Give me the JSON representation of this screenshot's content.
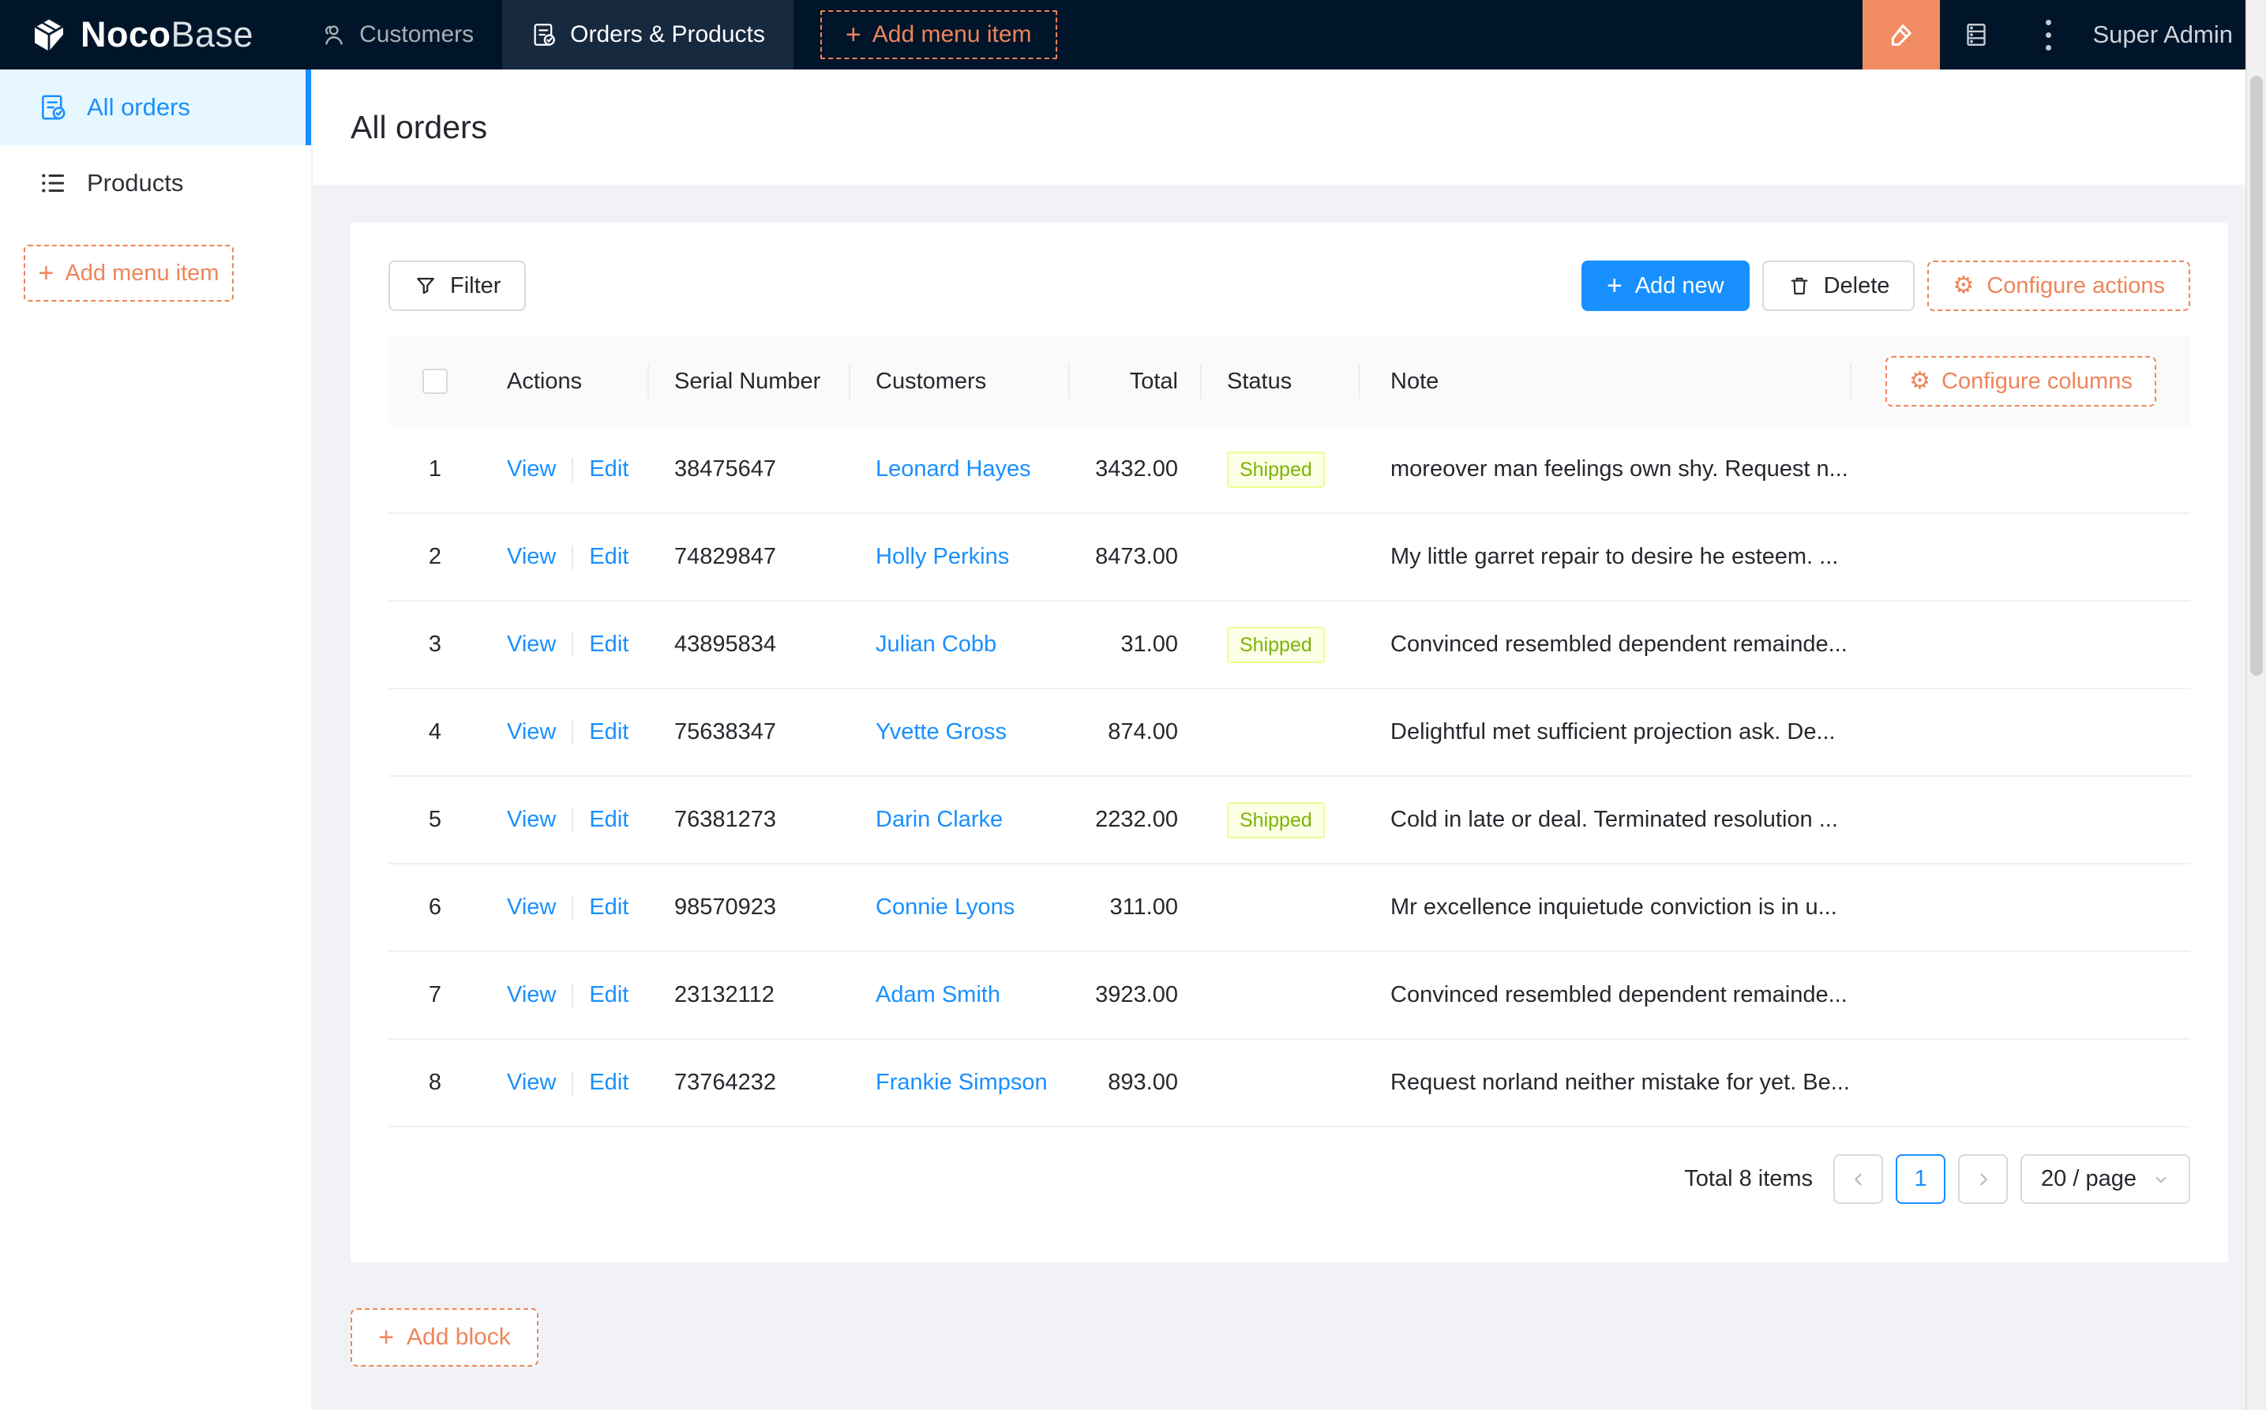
{
  "header": {
    "brand_bold": "Noco",
    "brand_light": "Base",
    "tabs": [
      {
        "label": "Customers",
        "active": false
      },
      {
        "label": "Orders & Products",
        "active": true
      }
    ],
    "add_menu_item_label": "Add menu item",
    "user_name": "Super Admin",
    "icons": [
      "highlighter-icon",
      "database-icon",
      "ellipsis-icon"
    ]
  },
  "sidebar": {
    "items": [
      {
        "label": "All orders",
        "icon": "orders-doc-check-icon",
        "active": true
      },
      {
        "label": "Products",
        "icon": "unordered-list-icon",
        "active": false
      }
    ],
    "add_menu_item_label": "Add menu item"
  },
  "page": {
    "title": "All orders",
    "add_block_label": "Add block"
  },
  "toolbar": {
    "filter_label": "Filter",
    "add_new_label": "Add new",
    "delete_label": "Delete",
    "configure_actions_label": "Configure actions"
  },
  "table": {
    "columns": [
      "Actions",
      "Serial Number",
      "Customers",
      "Total",
      "Status",
      "Note"
    ],
    "configure_columns_label": "Configure columns",
    "actions": {
      "view": "View",
      "edit": "Edit"
    },
    "rows": [
      {
        "index": "1",
        "serial": "38475647",
        "customer": "Leonard Hayes",
        "total": "3432.00",
        "status": "Shipped",
        "note": "moreover man feelings own shy. Request n..."
      },
      {
        "index": "2",
        "serial": "74829847",
        "customer": "Holly Perkins",
        "total": "8473.00",
        "status": "",
        "note": "My little garret repair to desire he esteem. ..."
      },
      {
        "index": "3",
        "serial": "43895834",
        "customer": "Julian Cobb",
        "total": "31.00",
        "status": "Shipped",
        "note": "Convinced resembled dependent remainde..."
      },
      {
        "index": "4",
        "serial": "75638347",
        "customer": "Yvette Gross",
        "total": "874.00",
        "status": "",
        "note": "Delightful met sufficient projection ask. De..."
      },
      {
        "index": "5",
        "serial": "76381273",
        "customer": "Darin Clarke",
        "total": "2232.00",
        "status": "Shipped",
        "note": "Cold in late or deal. Terminated resolution ..."
      },
      {
        "index": "6",
        "serial": "98570923",
        "customer": "Connie Lyons",
        "total": "311.00",
        "status": "",
        "note": "Mr excellence inquietude conviction is in u..."
      },
      {
        "index": "7",
        "serial": "23132112",
        "customer": "Adam Smith",
        "total": "3923.00",
        "status": "",
        "note": "Convinced resembled dependent remainde..."
      },
      {
        "index": "8",
        "serial": "73764232",
        "customer": "Frankie Simpson",
        "total": "893.00",
        "status": "",
        "note": "Request norland neither mistake for yet. Be..."
      }
    ]
  },
  "pagination": {
    "total_text": "Total 8 items",
    "current_page": "1",
    "page_size": "20 / page"
  },
  "colors": {
    "primary_blue": "#1890ff",
    "brand_orange": "#ee855a",
    "editor_button_orange": "#f18b62",
    "header_bg": "#001529",
    "sidebar_selected_bg": "#e6f7ff",
    "content_bg": "#f0f2f5",
    "tag_bg": "#fcffe6",
    "tag_border": "#eaff8f",
    "tag_text": "#7cb305"
  }
}
